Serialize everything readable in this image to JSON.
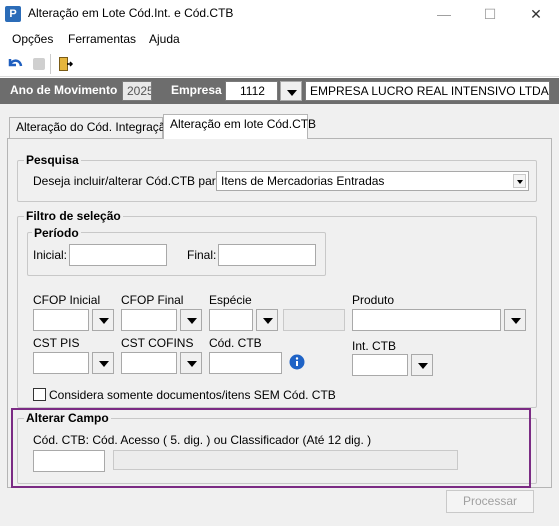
{
  "window": {
    "title": "Alteração em Lote Cód.Int. e Cód.CTB",
    "icon_letter": "P",
    "minimize": "—",
    "maximize": "☐",
    "close": "✕"
  },
  "menu": {
    "items": [
      "Opções",
      "Ferramentas",
      "Ajuda"
    ]
  },
  "toolbar": {
    "icons": [
      "undo-icon",
      "disabled-icon",
      "exit-door-icon"
    ]
  },
  "header": {
    "ano_label": "Ano de Movimento",
    "ano_value": "2025",
    "empresa_label": "Empresa",
    "empresa_code": "1112",
    "empresa_name": "EMPRESA LUCRO REAL INTENSIVO LTDA"
  },
  "tabs": [
    {
      "label": "Alteração do Cód. Integração",
      "active": false
    },
    {
      "label": "Alteração em lote Cód.CTB",
      "active": true
    }
  ],
  "pesquisa": {
    "title": "Pesquisa",
    "label": "Deseja incluir/alterar Cód.CTB para:",
    "selected": "Itens de Mercadorias Entradas"
  },
  "filtro": {
    "title": "Filtro de seleção",
    "periodo_title": "Período",
    "inicial_label": "Inicial:",
    "inicial_value": "",
    "final_label": "Final:",
    "final_value": "",
    "cfop_inicial_label": "CFOP Inicial",
    "cfop_final_label": "CFOP Final",
    "especie_label": "Espécie",
    "produto_label": "Produto",
    "cst_pis_label": "CST PIS",
    "cst_cofins_label": "CST COFINS",
    "cod_ctb_label": "Cód. CTB",
    "int_ctb_label": "Int. CTB",
    "checkbox_label": "Considera somente documentos/itens SEM Cód. CTB",
    "checkbox_checked": false
  },
  "alterar": {
    "title": "Alterar Campo",
    "label": "Cód. CTB: Cód. Acesso ( 5. dig. ) ou Classificador (Até 12 dig. )",
    "value": ""
  },
  "actions": {
    "processar": "Processar"
  },
  "colors": {
    "header_strip": "#6d6d6d",
    "highlight": "#7b2b84",
    "info_icon": "#1f63c6"
  }
}
